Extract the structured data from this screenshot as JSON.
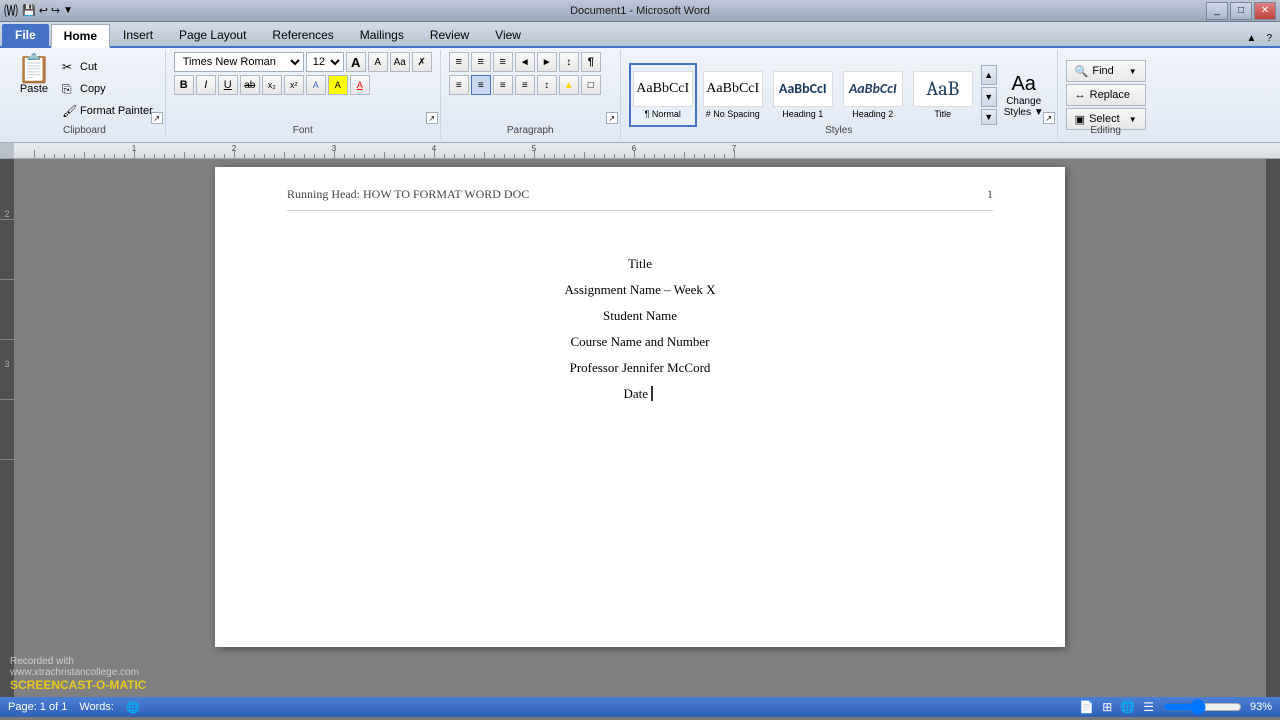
{
  "titlebar": {
    "title": "Document1 - Microsoft Word",
    "icons": [
      "word-icon",
      "undo-icon",
      "redo-icon",
      "save-icon",
      "customize-icon"
    ]
  },
  "tabs": {
    "items": [
      "File",
      "Home",
      "Insert",
      "Page Layout",
      "References",
      "Mailings",
      "Review",
      "View"
    ],
    "active": "Home"
  },
  "ribbon": {
    "clipboard": {
      "label": "Clipboard",
      "paste": "Paste",
      "cut": "Cut",
      "copy": "Copy",
      "format_painter": "Format Painter"
    },
    "font": {
      "label": "Font",
      "font_name": "Times New Roman",
      "font_size": "12",
      "grow": "A",
      "shrink": "A",
      "clear": "✗",
      "bold": "B",
      "italic": "I",
      "underline": "U",
      "strikethrough": "ab",
      "subscript": "x₂",
      "superscript": "x²",
      "highlight": "A",
      "font_color": "A"
    },
    "paragraph": {
      "label": "Paragraph",
      "bullets": "≡",
      "numbering": "≡",
      "multilevel": "≡",
      "decrease_indent": "←",
      "increase_indent": "→",
      "sort": "↕",
      "show_hide": "¶"
    },
    "styles": {
      "label": "Styles",
      "items": [
        {
          "name": "Normal",
          "preview": "AaBbCcI",
          "active": true
        },
        {
          "name": "No Spacing",
          "preview": "AaBbCcI",
          "active": false
        },
        {
          "name": "Heading 1",
          "preview": "AaBbCcI",
          "active": false
        },
        {
          "name": "Heading 2",
          "preview": "AaBbCcI",
          "active": false
        },
        {
          "name": "Title",
          "preview": "AaB",
          "active": false
        }
      ]
    },
    "editing": {
      "label": "Editing",
      "find": "Find",
      "replace": "Replace",
      "select": "Select"
    }
  },
  "document": {
    "header_text": "Running Head: HOW TO FORMAT WORD DOC",
    "page_number": "1",
    "content_lines": [
      "Title",
      "Assignment Name – Week X",
      "Student Name",
      "Course Name and Number",
      "Professor Jennifer McCord",
      "Date"
    ]
  },
  "statusbar": {
    "page": "Page: 1 of 1",
    "words": "Words:",
    "zoom": "93%"
  },
  "watermark": {
    "line1": "Recorded with",
    "line2": "www.xtrachristancollege.com",
    "logo": "SCREENCAST-O-MATIC"
  }
}
